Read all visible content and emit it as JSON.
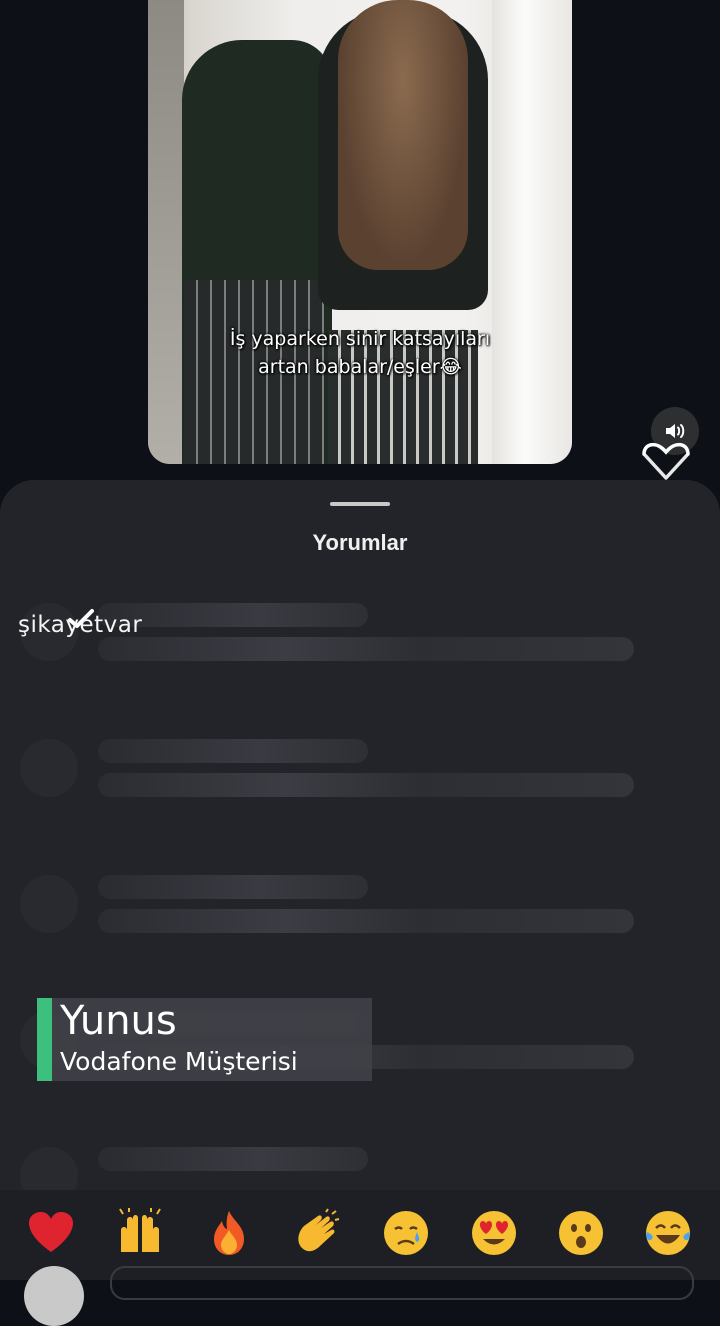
{
  "video": {
    "caption_line1": "İş yaparken sinir katsayıları",
    "caption_line2": "artan babalar/eşler😂"
  },
  "sheet": {
    "title": "Yorumlar"
  },
  "watermark": {
    "brand": "şikayetvar"
  },
  "lower_third": {
    "name": "Yunus",
    "subtitle": "Vodafone Müşterisi",
    "accent_color": "#3dbf7d"
  },
  "emoji_bar": {
    "items": [
      "heart",
      "raised-hands",
      "fire",
      "clapping-hands",
      "crying-face",
      "heart-eyes",
      "surprised-face",
      "tears-of-joy"
    ]
  },
  "colors": {
    "background": "#0d1117",
    "sheet": "#23242a"
  }
}
